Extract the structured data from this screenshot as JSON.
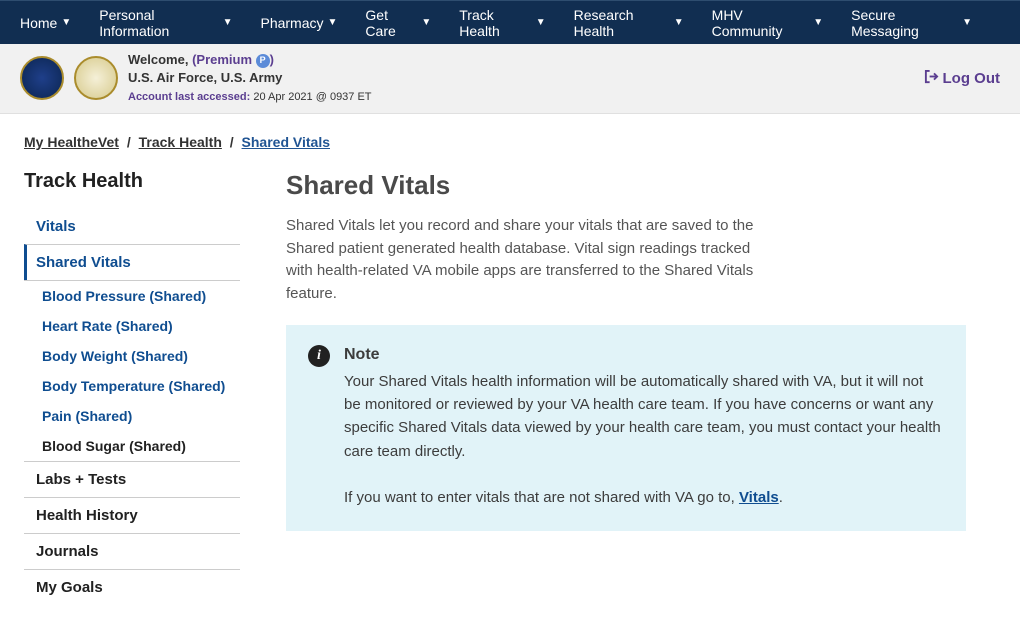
{
  "topnav": [
    "Home",
    "Personal Information",
    "Pharmacy",
    "Get Care",
    "Track Health",
    "Research Health",
    "MHV Community",
    "Secure Messaging"
  ],
  "user": {
    "welcome_prefix": "Welcome, ",
    "premium_label": "Premium",
    "branch": "U.S. Air Force, U.S. Army",
    "accessed_label": "Account last accessed:",
    "accessed_value": " 20 Apr 2021 @ 0937 ET"
  },
  "logout": "Log Out",
  "breadcrumb": {
    "a": "My HealtheVet",
    "b": "Track Health",
    "c": "Shared Vitals"
  },
  "sidebar": {
    "heading": "Track Health",
    "vitals": "Vitals",
    "shared_vitals": "Shared Vitals",
    "sub": {
      "bp": "Blood Pressure (Shared)",
      "hr": "Heart Rate (Shared)",
      "bw": "Body Weight (Shared)",
      "bt": "Body Temperature (Shared)",
      "pain": "Pain (Shared)",
      "bs": "Blood Sugar (Shared)"
    },
    "labs": "Labs + Tests",
    "history": "Health History",
    "journals": "Journals",
    "goals": "My Goals"
  },
  "content": {
    "title": "Shared Vitals",
    "intro": "Shared Vitals let you record and share your vitals that are saved to the Shared patient generated health database. Vital sign readings tracked with health-related VA mobile apps are transferred to the Shared Vitals feature.",
    "note_title": "Note",
    "note_body": "Your Shared Vitals health information will be automatically shared with VA, but it will not be monitored or reviewed by your VA health care team. If you have concerns or want any specific Shared Vitals data viewed by your health care team, you must contact your health care team directly.",
    "note_footer_prefix": "If you want to enter vitals that are not shared with VA go to, ",
    "note_footer_link": "Vitals",
    "note_footer_suffix": "."
  }
}
